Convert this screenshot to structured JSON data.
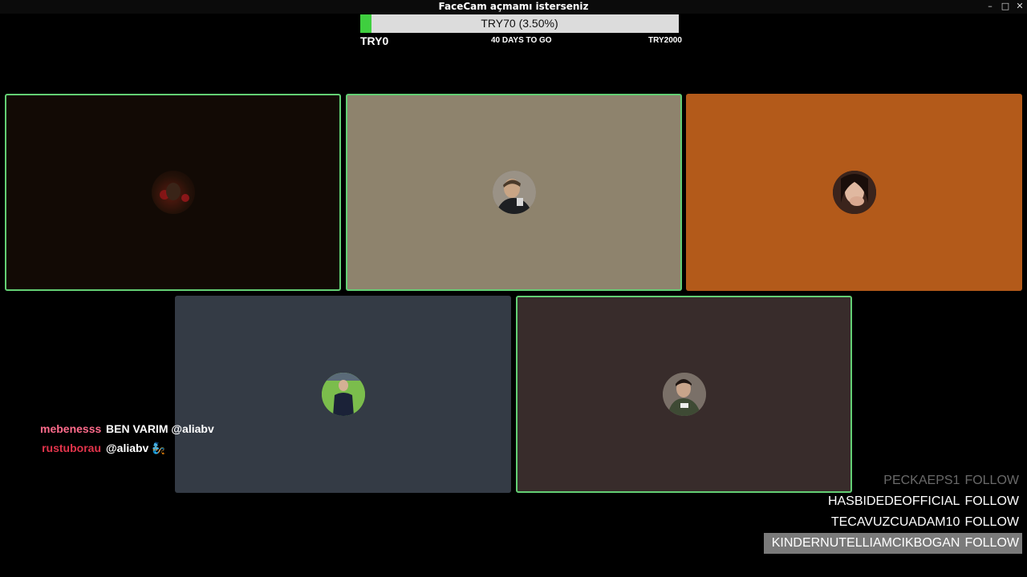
{
  "window": {
    "title": "FaceCam açmamı isterseniz",
    "controls": {
      "minimize": "–",
      "maximize": "□",
      "close": "✕"
    }
  },
  "goal": {
    "text": "TRY70 (3.50%)",
    "progress": 0.035,
    "min_label": "TRY0",
    "days_label": "40 DAYS TO GO",
    "max_label": "TRY2000",
    "fill_color": "#3fcf3f"
  },
  "tiles": [
    {
      "bg": "#120a05",
      "active": true,
      "avatar": "avatar-dark-red"
    },
    {
      "bg": "#8e836d",
      "active": true,
      "avatar": "avatar-man-phone"
    },
    {
      "bg": "#b35a1a",
      "active": false,
      "avatar": "avatar-woman-hand"
    },
    {
      "bg": "#343b45",
      "active": false,
      "avatar": "avatar-man-suit"
    },
    {
      "bg": "#382c2b",
      "active": true,
      "avatar": "avatar-man-sitting"
    }
  ],
  "chat": [
    {
      "user": "mebenesss",
      "user_color": "#ff6b8b",
      "message": "BEN VARIM @aliabv"
    },
    {
      "user": "rustuborau",
      "user_color": "#e2344b",
      "message": "@aliabv 🧞"
    }
  ],
  "follows": [
    {
      "name": "PECKAEPS1",
      "action": "FOLLOW",
      "faded": true
    },
    {
      "name": "HASBIDEDEOFFICIAL",
      "action": "FOLLOW",
      "faded": false
    },
    {
      "name": "TECAVUZCUADAM10",
      "action": "FOLLOW",
      "faded": false
    },
    {
      "name": "KINDERNUTELLIAMCIKBOGAN",
      "action": "FOLLOW",
      "faded": false,
      "highlighted": true
    }
  ]
}
